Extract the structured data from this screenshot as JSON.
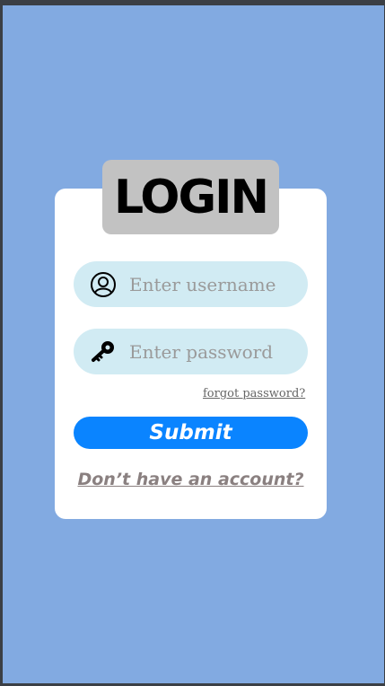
{
  "login": {
    "title": "LOGIN",
    "username": {
      "placeholder": "Enter username",
      "icon": "user-icon"
    },
    "password": {
      "placeholder": "Enter password",
      "icon": "key-icon"
    },
    "forgot_label": "forgot password?",
    "submit_label": "Submit",
    "signup_label": "Don’t  have an account?"
  },
  "colors": {
    "background": "#82aae1",
    "card": "#ffffff",
    "title_box": "#c2c2c2",
    "field": "#d1ebf3",
    "submit": "#0a84ff"
  }
}
